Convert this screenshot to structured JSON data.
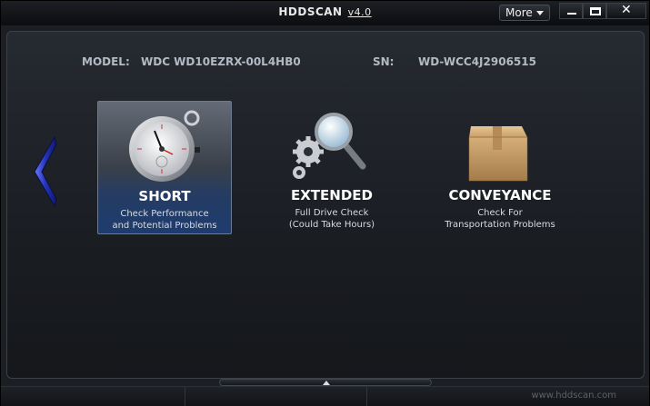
{
  "window": {
    "app_name": "HDDSCAN",
    "version": "v4.0",
    "more_label": "More",
    "close_glyph": "✕"
  },
  "drive": {
    "model_label": "MODEL:",
    "model_value": "WDC WD10EZRX-00L4HB0",
    "sn_label": "SN:",
    "sn_value": "WD-WCC4J2906515"
  },
  "tests": [
    {
      "title": "SHORT",
      "desc_line1": "Check Performance",
      "desc_line2": "and Potential Problems",
      "icon": "stopwatch-icon",
      "selected": true
    },
    {
      "title": "EXTENDED",
      "desc_line1": "Full Drive Check",
      "desc_line2": "(Could Take Hours)",
      "icon": "gears-magnifier-icon",
      "selected": false
    },
    {
      "title": "CONVEYANCE",
      "desc_line1": "Check For",
      "desc_line2": "Transportation Problems",
      "icon": "cardboard-box-icon",
      "selected": false
    }
  ],
  "status": {
    "url": "www.hddscan.com"
  },
  "colors": {
    "selected_tile": "#1e3c6f",
    "nav_arrow": "#2433b8"
  }
}
